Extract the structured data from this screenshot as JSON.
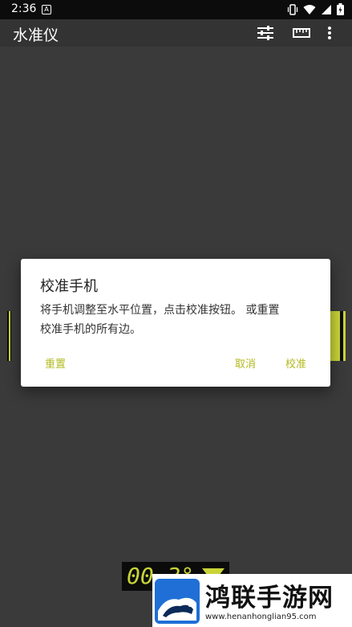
{
  "status_bar": {
    "time": "2:36",
    "notification_icon": "a-icon",
    "icons": [
      "vibrate-icon",
      "wifi-icon",
      "signal-icon",
      "battery-charging-icon"
    ]
  },
  "app_bar": {
    "title": "水准仪",
    "actions": [
      "tune-icon",
      "ruler-icon",
      "more-vert-icon"
    ]
  },
  "readout": {
    "text": "00.3°"
  },
  "dialog": {
    "title": "校准手机",
    "message_line1": "将手机调整至水平位置，点击校准按钮。 或重置",
    "message_line2": "校准手机的所有边。",
    "reset_label": "重置",
    "cancel_label": "取消",
    "calibrate_label": "校准"
  },
  "watermark": {
    "name": "鸿联手游网",
    "url": "www.henanhonglian95.com"
  },
  "colors": {
    "accent": "#b3b91f",
    "gauge": "#c9d437",
    "scrim_background": "#3a3a3a"
  }
}
